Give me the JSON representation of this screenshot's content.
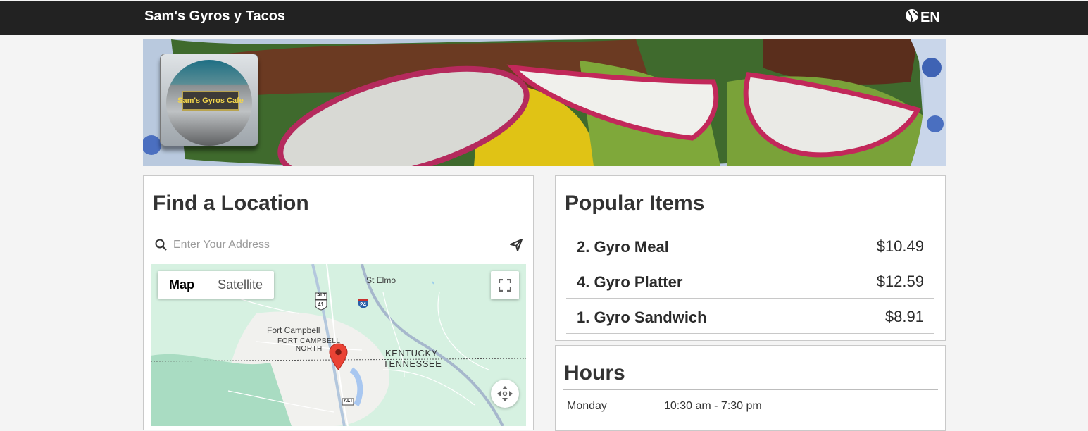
{
  "navbar": {
    "brand": "Sam's Gyros y Tacos",
    "language": "EN",
    "language_icon": "globe-icon"
  },
  "hero": {
    "logo_sign_text": "Sam's Gyros Cafe"
  },
  "find_location": {
    "title": "Find a Location",
    "search": {
      "placeholder": "Enter Your Address",
      "value": ""
    },
    "map": {
      "types": [
        "Map",
        "Satellite"
      ],
      "selected_type": "Map",
      "labels": {
        "st_elmo": "St Elmo",
        "fort_campbell": "Fort Campbell",
        "fort_campbell_north": "FORT CAMPBELL\nNORTH",
        "kentucky": "KENTUCKY",
        "tennessee": "TENNESSEE",
        "route_41_alt": "ALT",
        "route_41": "41",
        "interstate_24": "24",
        "route_alt_bottom": "ALT"
      }
    }
  },
  "popular_items": {
    "title": "Popular Items",
    "items": [
      {
        "name": "2. Gyro Meal",
        "price": "$10.49"
      },
      {
        "name": "4. Gyro Platter",
        "price": "$12.59"
      },
      {
        "name": "1. Gyro Sandwich",
        "price": "$8.91"
      }
    ]
  },
  "hours": {
    "title": "Hours",
    "rows": [
      {
        "day": "Monday",
        "time": "10:30 am - 7:30 pm"
      }
    ]
  },
  "colors": {
    "navbar": "#222222",
    "map_marker": "#ea4335",
    "interstate": "#2a5fa8"
  }
}
